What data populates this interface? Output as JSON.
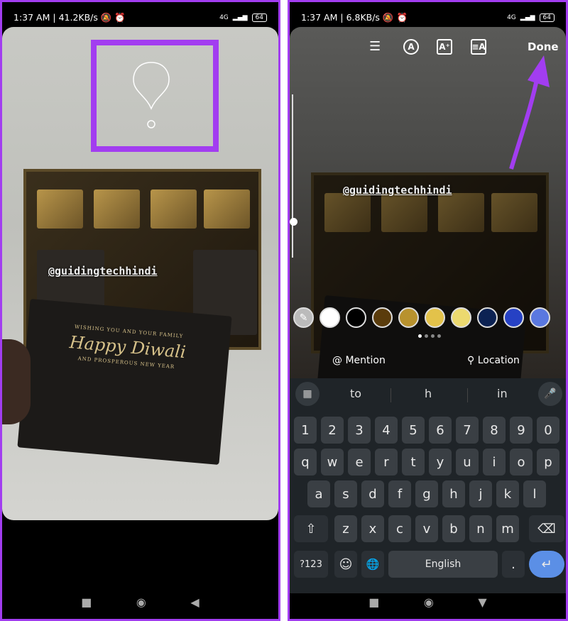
{
  "left": {
    "status": {
      "time": "1:37 AM",
      "speed": "41.2KB/s",
      "network": "4G",
      "battery": "64"
    },
    "tag": "@guidingtechhindi",
    "card": {
      "line1": "WISHING YOU AND YOUR FAMILY",
      "line2": "Happy Diwali",
      "line3": "AND PROSPEROUS NEW YEAR"
    },
    "highlight_color": "#a23df0"
  },
  "right": {
    "status": {
      "time": "1:37 AM",
      "speed": "6.8KB/s",
      "network": "4G",
      "battery": "64"
    },
    "toolbar": {
      "align_icon": "align-center-icon",
      "font_icon": "font-icon",
      "effect_icon": "text-effect-icon",
      "animate_icon": "text-animate-icon",
      "done": "Done"
    },
    "tag": "@guidingtechhindi",
    "colors": [
      "#ffffff",
      "#000000",
      "#5a3c0c",
      "#b8922e",
      "#e3c24a",
      "#ecd96f",
      "#0c2253",
      "#2641c4",
      "#5a78e0"
    ],
    "color_page": 1,
    "color_pages": 4,
    "mention": "Mention",
    "location": "Location",
    "keyboard": {
      "suggestions": [
        "to",
        "h",
        "in"
      ],
      "row1": [
        "1",
        "2",
        "3",
        "4",
        "5",
        "6",
        "7",
        "8",
        "9",
        "0"
      ],
      "row2": [
        "q",
        "w",
        "e",
        "r",
        "t",
        "y",
        "u",
        "i",
        "o",
        "p"
      ],
      "row3": [
        "a",
        "s",
        "d",
        "f",
        "g",
        "h",
        "j",
        "k",
        "l"
      ],
      "row4": [
        "z",
        "x",
        "c",
        "v",
        "b",
        "n",
        "m"
      ],
      "symbols": "?123",
      "emoji": "☺",
      "comma": ",",
      "globe": "🌐",
      "space": "English",
      "period": ".",
      "enter": "↵",
      "shift": "⇧",
      "backspace": "⌫"
    }
  }
}
